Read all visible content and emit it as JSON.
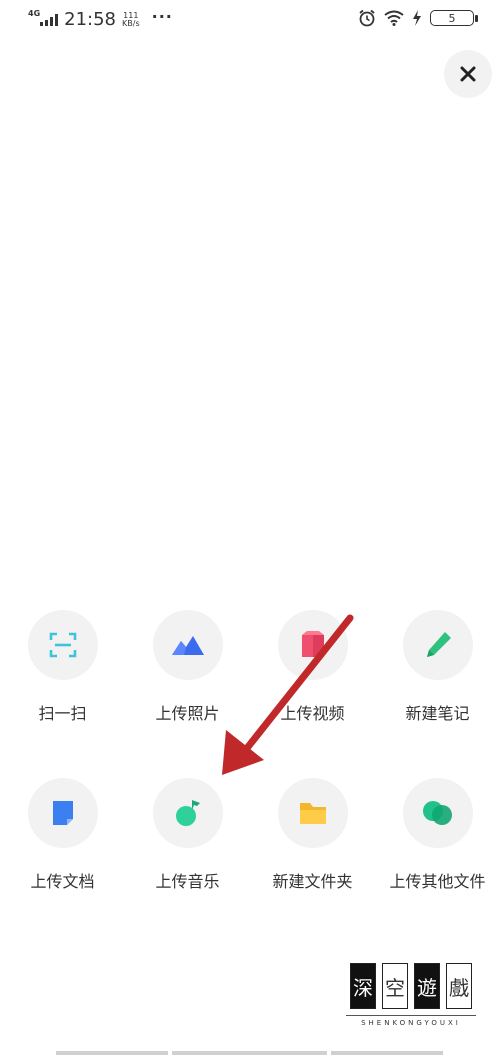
{
  "status_bar": {
    "network": "4G",
    "time": "21:58",
    "speed_value": "111",
    "speed_unit": "KB/s",
    "more": "···",
    "battery": "5",
    "icons": [
      "signal-icon",
      "alarm-icon",
      "wifi-icon",
      "charging-icon",
      "battery-icon"
    ]
  },
  "close_icon": "close-icon",
  "actions": [
    {
      "label": "扫一扫",
      "icon": "scan-icon",
      "color": "#3ec3d8"
    },
    {
      "label": "上传照片",
      "icon": "mountain-photo-icon",
      "color": "#3b6cf0"
    },
    {
      "label": "上传视频",
      "icon": "video-icon",
      "color": "#f0506e"
    },
    {
      "label": "新建笔记",
      "icon": "pen-icon",
      "color": "#2ec27e"
    },
    {
      "label": "上传文档",
      "icon": "document-icon",
      "color": "#3b7ff0"
    },
    {
      "label": "上传音乐",
      "icon": "music-note-icon",
      "color": "#2ed19a"
    },
    {
      "label": "新建文件夹",
      "icon": "folder-icon",
      "color": "#f5b62a"
    },
    {
      "label": "上传其他文件",
      "icon": "other-files-icon",
      "color": "#20c28a"
    }
  ],
  "annotation_arrow_color": "#c0282a",
  "watermark": {
    "chars": [
      "深",
      "空",
      "遊",
      "戲"
    ],
    "subtitle": "SHENKONGYOUXI"
  }
}
